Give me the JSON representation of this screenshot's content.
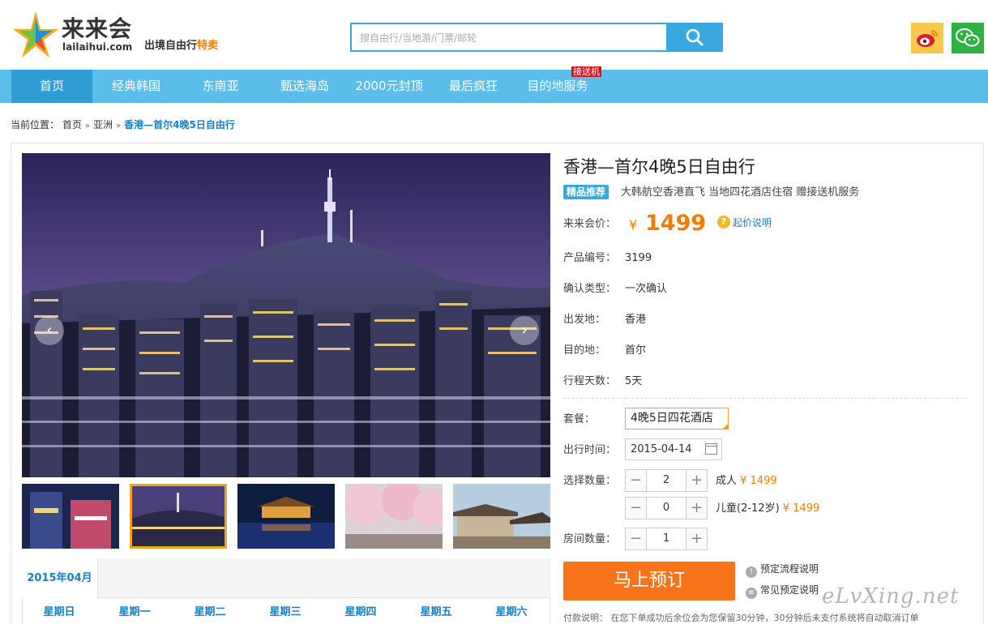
{
  "header": {
    "logo_name": "来来会",
    "logo_domain": "lailaihui.com",
    "slogan_main": "出境自由行",
    "slogan_accent": "特卖",
    "search_placeholder": "搜自由行/当地游/门票/邮轮"
  },
  "nav": {
    "items": [
      "首页",
      "经典韩国",
      "东南亚",
      "甄选海岛",
      "2000元封顶",
      "最后疯狂",
      "目的地服务"
    ],
    "badge": "接送机"
  },
  "breadcrumb": {
    "prefix": "当前位置：",
    "items": [
      "首页",
      "亚洲",
      "香港—首尔4晚5日自由行"
    ],
    "separator": "»"
  },
  "product": {
    "title": "香港—首尔4晚5日自由行",
    "tag": "精品推荐",
    "subtitle": "大韩航空香港直飞 当地四花酒店住宿 赠接送机服务",
    "price_label": "来来会价：",
    "currency": "¥",
    "price": "1499",
    "price_help": "起价说明",
    "code_label": "产品编号：",
    "code": "3199",
    "confirm_label": "确认类型：",
    "confirm": "一次确认",
    "depart_label": "出发地：",
    "depart": "香港",
    "dest_label": "目的地：",
    "dest": "首尔",
    "days_label": "行程天数：",
    "days": "5天"
  },
  "booking": {
    "package_label": "套餐：",
    "package": "4晚5日四花酒店",
    "date_label": "出行时间：",
    "date": "2015-04-14",
    "qty_label": "选择数量：",
    "adult_qty": "2",
    "adult_label": "成人",
    "adult_price": "¥ 1499",
    "child_qty": "0",
    "child_label": "儿童(2-12岁)",
    "child_price": "¥ 1499",
    "room_label": "房间数量：",
    "room_qty": "1",
    "minus": "−",
    "plus": "+",
    "book_button": "马上预订",
    "link_process": "预定流程说明",
    "link_faq": "常见预定说明",
    "pay_note": "付款说明： 在您下单成功后余位会为您保留30分钟，30分钟后未支付系统将自动取消订单"
  },
  "calendar": {
    "month": "2015年04月",
    "weekdays": [
      "星期日",
      "星期一",
      "星期二",
      "星期三",
      "星期四",
      "星期五",
      "星期六"
    ]
  },
  "gallery": {
    "prev": "‹",
    "next": "›"
  },
  "watermark": "eLvXing.net",
  "colors": {
    "brand_blue": "#3aa8e0",
    "nav_blue": "#5bbdea",
    "price_orange": "#f07d00",
    "book_orange": "#f7741a"
  }
}
